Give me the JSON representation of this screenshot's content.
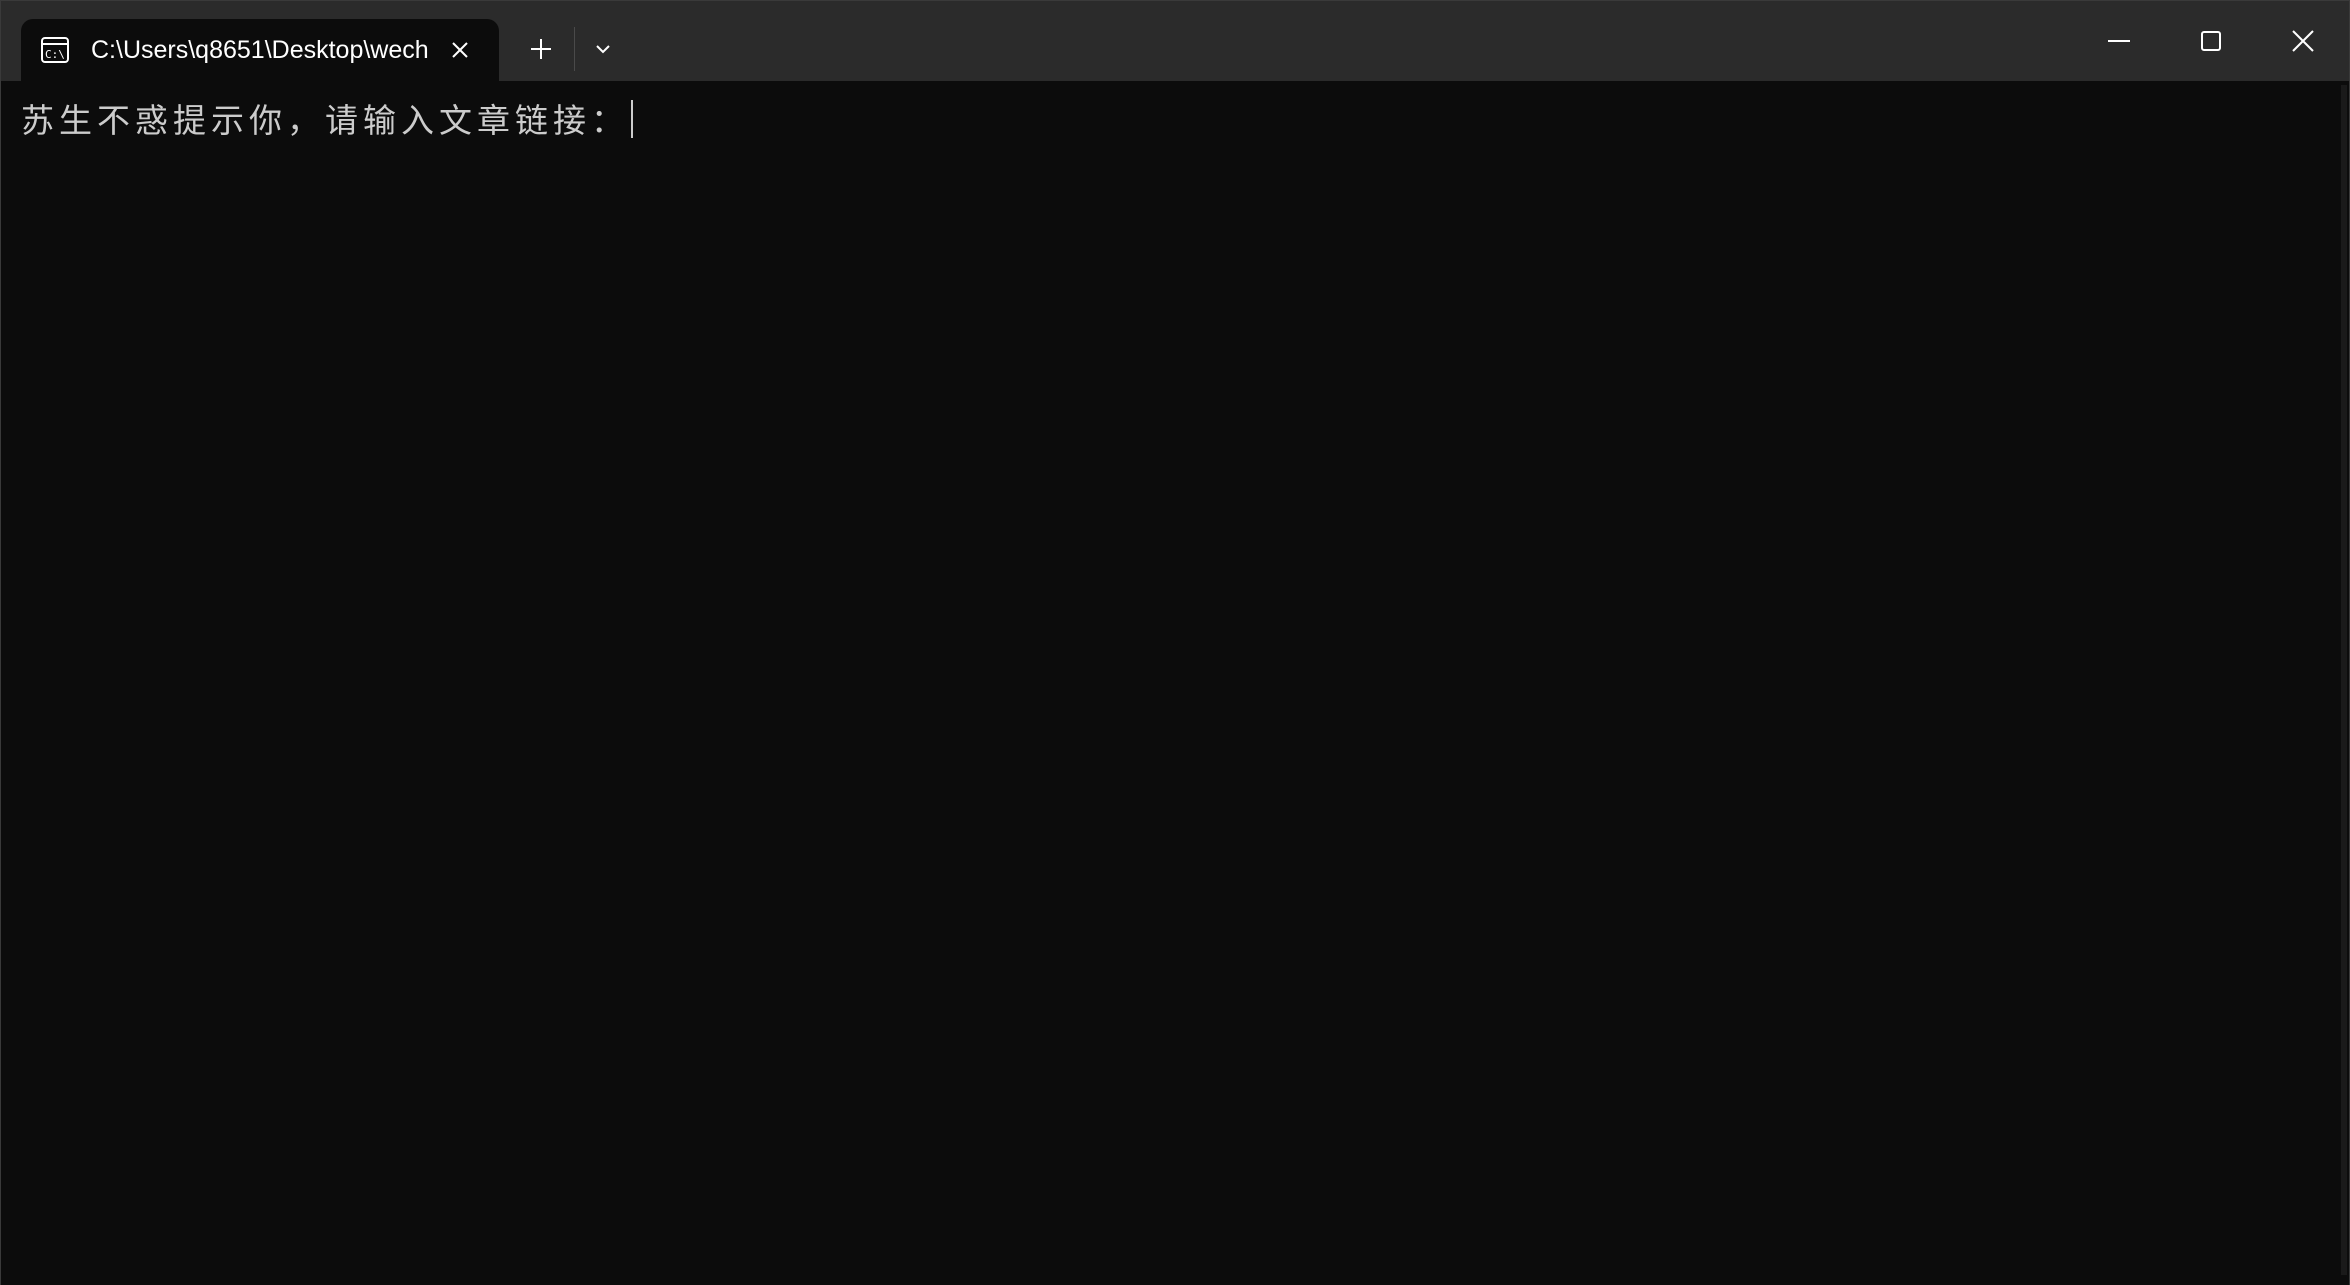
{
  "window": {
    "tab_title": "C:\\Users\\q8651\\Desktop\\wech",
    "tab_icon": "cmd-icon"
  },
  "titlebar": {
    "new_tab_icon": "plus-icon",
    "dropdown_icon": "chevron-down-icon",
    "minimize_icon": "minimize-icon",
    "maximize_icon": "maximize-icon",
    "close_icon": "close-icon"
  },
  "console": {
    "prompt_text": "苏生不惑提示你，请输入文章链接："
  },
  "colors": {
    "titlebar_bg": "#2b2b2b",
    "console_bg": "#0c0c0c",
    "console_text": "#cccccc"
  }
}
